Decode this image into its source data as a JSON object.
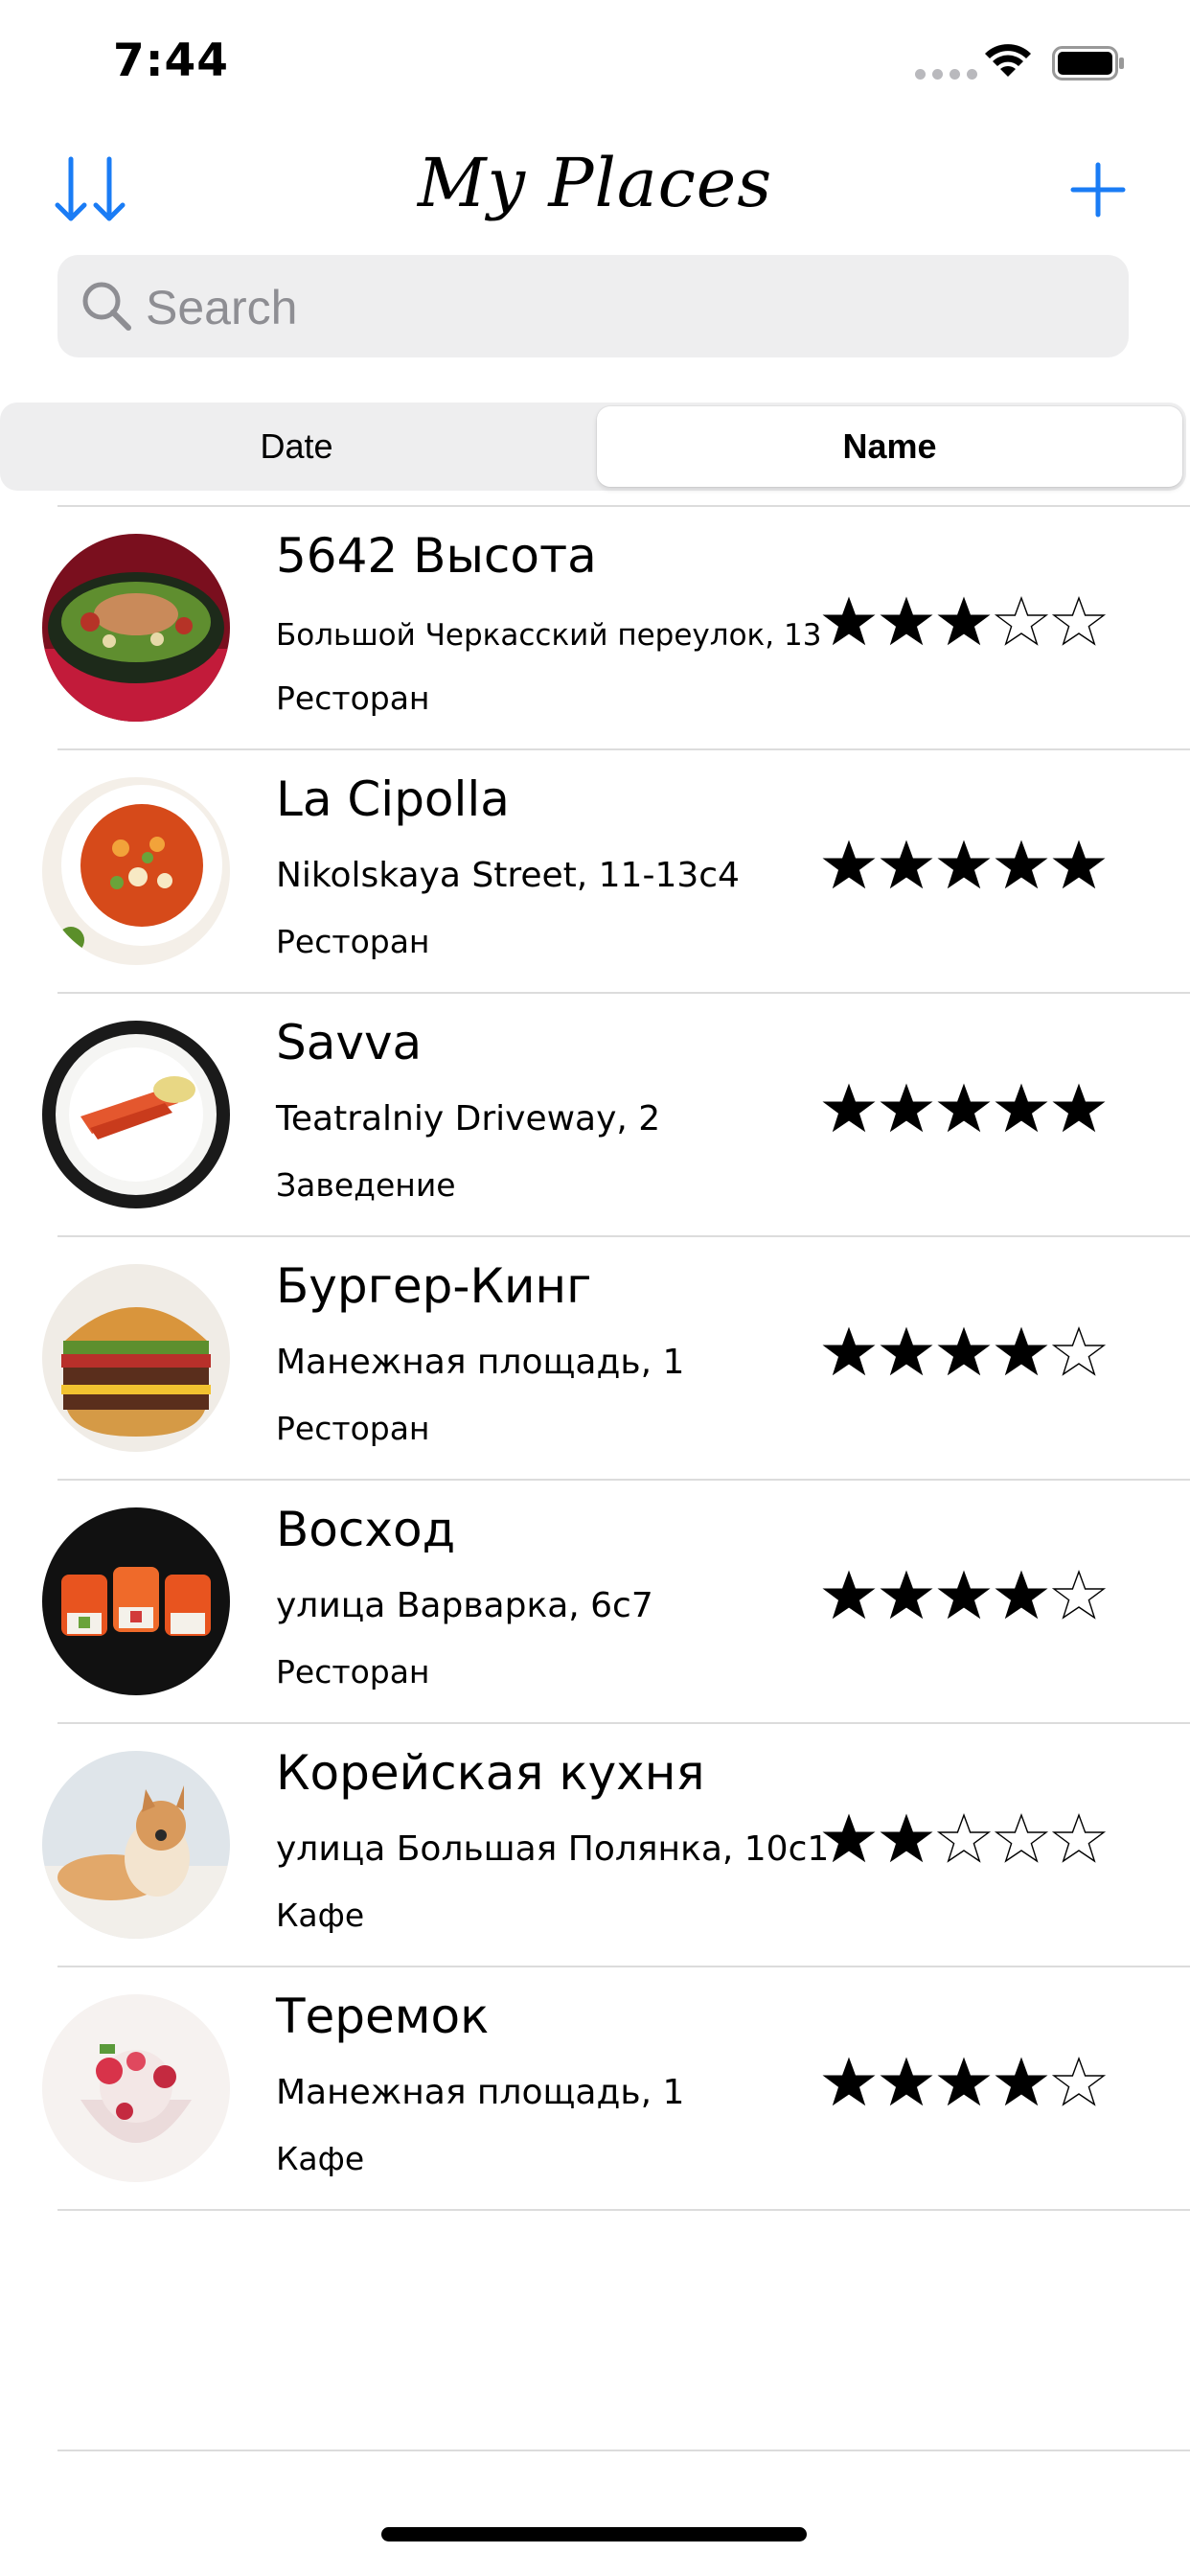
{
  "status_bar": {
    "time": "7:44"
  },
  "nav": {
    "title": "My Places",
    "sort_icon": "sort-arrows-icon",
    "add_icon": "plus-icon",
    "accent": "#1a7cf5"
  },
  "search": {
    "placeholder": "Search",
    "value": ""
  },
  "segments": {
    "left": "Date",
    "right": "Name",
    "selected": "Name"
  },
  "places": [
    {
      "name": "5642 Высота",
      "address": "Большой Черкасский переулок, 13",
      "type": "Ресторан",
      "rating": 3
    },
    {
      "name": "La Cipolla",
      "address": "Nikolskaya Street, 11-13c4",
      "type": "Ресторан",
      "rating": 5
    },
    {
      "name": "Savva",
      "address": "Teatralniy Driveway, 2",
      "type": "Заведение",
      "rating": 5
    },
    {
      "name": "Бургер-Кинг",
      "address": "Манежная площадь, 1",
      "type": "Ресторан",
      "rating": 4
    },
    {
      "name": "Восход",
      "address": "улица Варварка, 6с7",
      "type": "Ресторан",
      "rating": 4
    },
    {
      "name": "Корейская кухня",
      "address": "улица Большая Полянка, 10с1",
      "type": "Кафе",
      "rating": 2
    },
    {
      "name": "Теремок",
      "address": "Манежная площадь, 1",
      "type": "Кафе",
      "rating": 4
    }
  ]
}
